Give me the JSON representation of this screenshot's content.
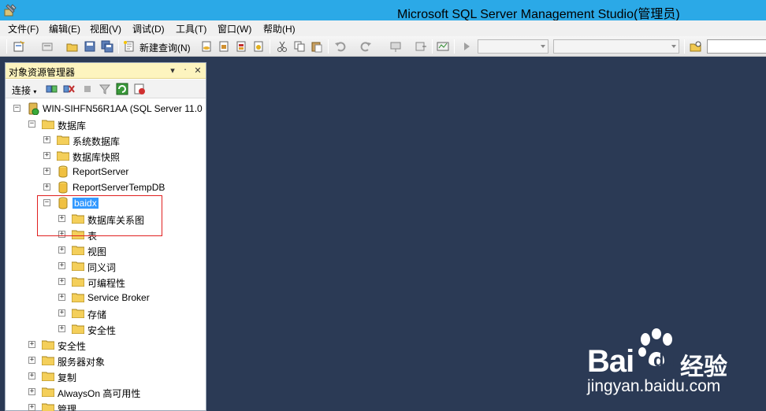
{
  "window": {
    "title": "Microsoft SQL Server Management Studio(管理员)"
  },
  "menu": [
    "文件(F)",
    "编辑(E)",
    "视图(V)",
    "调试(D)",
    "工具(T)",
    "窗口(W)",
    "帮助(H)"
  ],
  "toolbar": {
    "new_query_label": "新建查询(N)"
  },
  "object_explorer": {
    "title": "对象资源管理器",
    "pin_glyph": "▾",
    "dock_glyph": "᛫",
    "close_glyph": "✕",
    "connect_label": "连接",
    "tree": [
      {
        "label": "WIN-SIHFN56R1AA (SQL Server 11.0",
        "expander": "⊟"
      },
      {
        "label": "数据库",
        "expander": "⊟"
      },
      {
        "label": "系统数据库",
        "expander": "⊞"
      },
      {
        "label": "数据库快照",
        "expander": "⊞"
      },
      {
        "label": "ReportServer",
        "expander": "⊞"
      },
      {
        "label": "ReportServerTempDB",
        "expander": "⊞"
      },
      {
        "label": "baidx",
        "expander": "⊟"
      },
      {
        "label": "数据库关系图",
        "expander": "⊞"
      },
      {
        "label": "表",
        "expander": "⊞"
      },
      {
        "label": "视图",
        "expander": "⊞"
      },
      {
        "label": "同义词",
        "expander": "⊞"
      },
      {
        "label": "可编程性",
        "expander": "⊞"
      },
      {
        "label": "Service Broker",
        "expander": "⊞"
      },
      {
        "label": "存储",
        "expander": "⊞"
      },
      {
        "label": "安全性",
        "expander": "⊞"
      },
      {
        "label": "安全性",
        "expander": "⊞"
      },
      {
        "label": "服务器对象",
        "expander": "⊞"
      },
      {
        "label": "复制",
        "expander": "⊞"
      },
      {
        "label": "AlwaysOn 高可用性",
        "expander": "⊞"
      },
      {
        "label": "管理",
        "expander": "⊞"
      }
    ]
  },
  "watermark": {
    "brand": "Bai",
    "brand_suffix": "经验",
    "url": "jingyan.baidu.com"
  },
  "colors": {
    "titlebar": "#2ba9e7",
    "workspace": "#2b3a55",
    "panel_header": "#fdf4bf",
    "selection": "#3399ff",
    "highlight_box": "#e02020"
  }
}
